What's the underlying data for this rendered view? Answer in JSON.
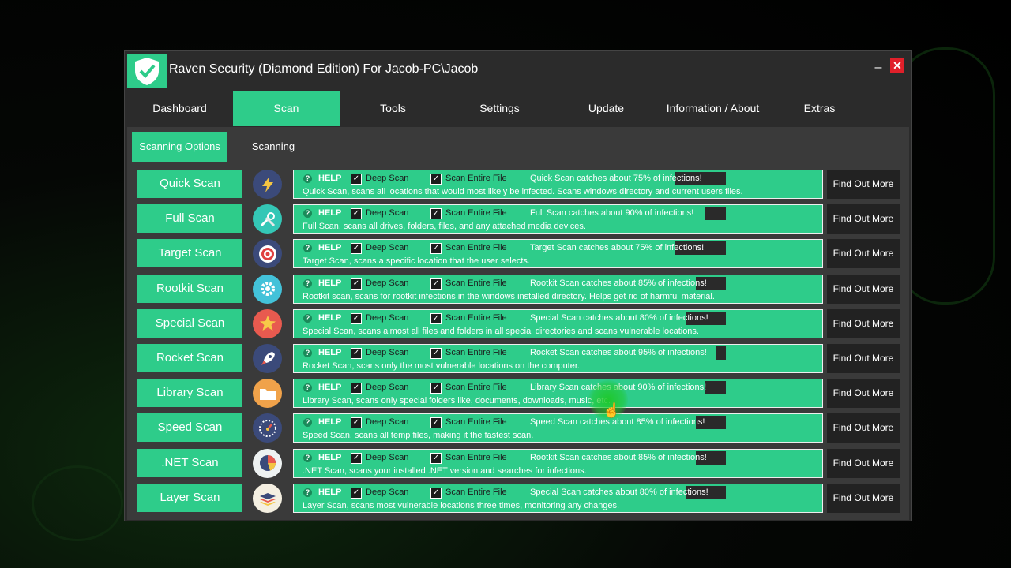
{
  "window": {
    "title": "Raven Security  (Diamond Edition)  For Jacob-PC\\Jacob",
    "minimize_label": "–",
    "close_label": "✕"
  },
  "tabs": [
    {
      "label": "Dashboard",
      "active": false
    },
    {
      "label": "Scan",
      "active": true
    },
    {
      "label": "Tools",
      "active": false
    },
    {
      "label": "Settings",
      "active": false
    },
    {
      "label": "Update",
      "active": false
    },
    {
      "label": "Information / About",
      "active": false
    },
    {
      "label": "Extras",
      "active": false
    }
  ],
  "subtabs": [
    {
      "label": "Scanning Options",
      "active": true
    },
    {
      "label": "Scanning",
      "active": false
    }
  ],
  "labels": {
    "help": "HELP",
    "deep_scan": "Deep Scan",
    "entire_file": "Scan Entire File",
    "find_out_more": "Find Out More"
  },
  "scans": [
    {
      "name": "Quick Scan",
      "icon": "lightning-icon",
      "icon_bg": "#3b4a7a",
      "rate": "Quick Scan catches about 75% of infections!",
      "fill": 0.75,
      "desc": "Quick Scan, scans all locations that would most likely be infected. Scans windows directory and current users files."
    },
    {
      "name": "Full Scan",
      "icon": "tools-icon",
      "icon_bg": "#34c7b6",
      "rate": "Full Scan catches about 90% of infections!",
      "fill": 0.9,
      "desc": "Full Scan, scans all drives, folders, files, and any attached media devices."
    },
    {
      "name": "Target Scan",
      "icon": "target-icon",
      "icon_bg": "#3b4a7a",
      "rate": "Target Scan catches about 75% of infections!",
      "fill": 0.75,
      "desc": "Target Scan, scans a specific location that the user selects."
    },
    {
      "name": "Rootkit Scan",
      "icon": "gear-icon",
      "icon_bg": "#43c2d9",
      "rate": "Rootkit Scan catches about 85% of infections!",
      "fill": 0.85,
      "desc": "Rootkit scan, scans for rootkit infections in the windows installed directory. Helps get rid of harmful material."
    },
    {
      "name": "Special Scan",
      "icon": "star-icon",
      "icon_bg": "#e85a4f",
      "rate": "Special Scan catches about 80% of infections!",
      "fill": 0.8,
      "desc": "Special Scan, scans almost all files and folders in all special directories and scans vulnerable locations."
    },
    {
      "name": "Rocket Scan",
      "icon": "rocket-icon",
      "icon_bg": "#3b4a7a",
      "rate": "Rocket Scan catches about 95% of infections!",
      "fill": 0.95,
      "desc": "Rocket Scan, scans only the most vulnerable locations on the computer."
    },
    {
      "name": "Library Scan",
      "icon": "folder-icon",
      "icon_bg": "#f0a24a",
      "rate": "Library Scan catches about 90% of infections!",
      "fill": 0.9,
      "desc": "Library Scan, scans only special folders like, documents, downloads, music, etc."
    },
    {
      "name": "Speed Scan",
      "icon": "speedometer-icon",
      "icon_bg": "#3b4a7a",
      "rate": "Speed Scan catches about 85% of infections!",
      "fill": 0.85,
      "desc": "Speed Scan, scans all temp files, making it the fastest scan."
    },
    {
      "name": ".NET Scan",
      "icon": "pie-chart-icon",
      "icon_bg": "#eef2f2",
      "rate": "Rootkit Scan catches about 85% of infections!",
      "fill": 0.85,
      "desc": ".NET Scan, scans your installed .NET version and searches for infections."
    },
    {
      "name": "Layer Scan",
      "icon": "layers-icon",
      "icon_bg": "#f4efe1",
      "rate": "Special Scan catches about 80% of infections!",
      "fill": 0.8,
      "desc": "Layer Scan, scans most vulnerable locations three times, monitoring any changes."
    }
  ]
}
